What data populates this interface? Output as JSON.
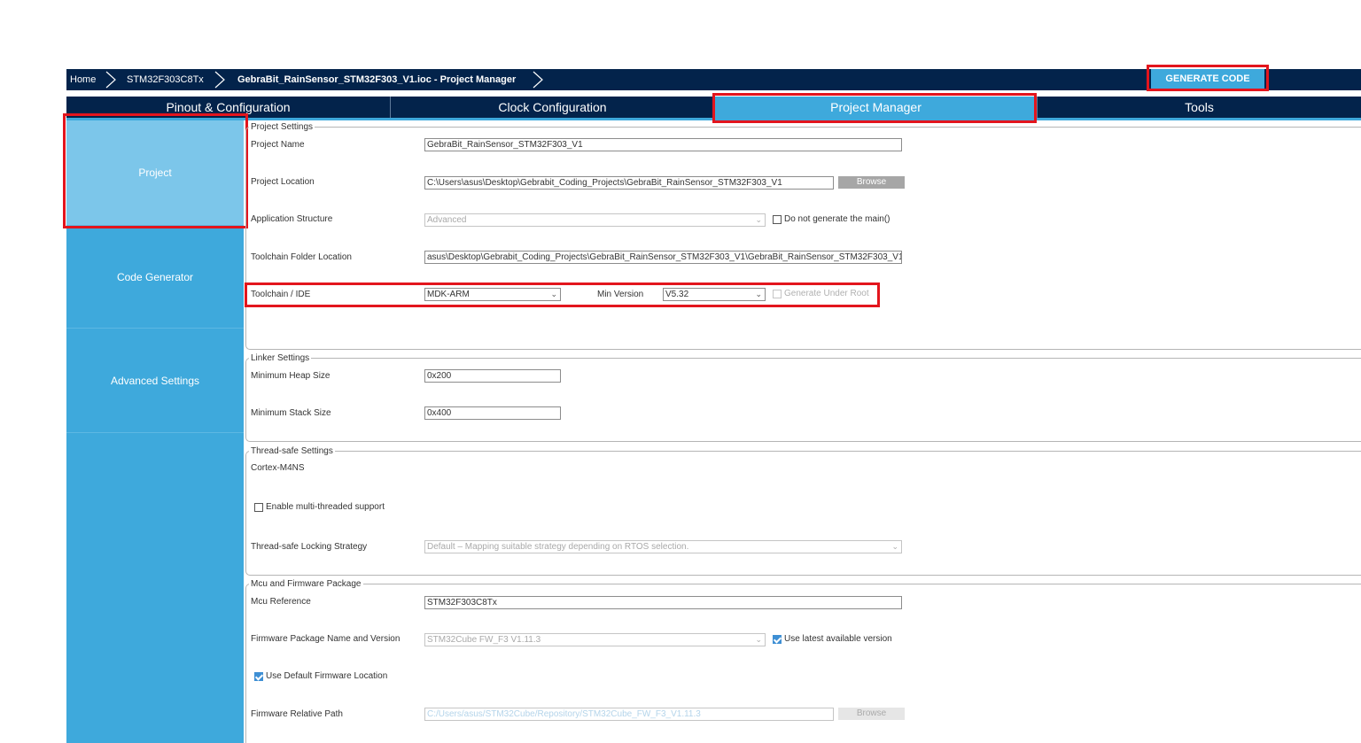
{
  "breadcrumb": {
    "home": "Home",
    "mcu": "STM32F303C8Tx",
    "file": "GebraBit_RainSensor_STM32F303_V1.ioc - Project Manager"
  },
  "toolbar": {
    "generate_code": "GENERATE CODE"
  },
  "tabs": [
    {
      "label": "Pinout & Configuration"
    },
    {
      "label": "Clock Configuration"
    },
    {
      "label": "Project Manager"
    },
    {
      "label": "Tools"
    }
  ],
  "sidebar": {
    "items": [
      {
        "label": "Project"
      },
      {
        "label": "Code Generator"
      },
      {
        "label": "Advanced Settings"
      }
    ]
  },
  "project_settings": {
    "title": "Project Settings",
    "project_name_label": "Project Name",
    "project_name": "GebraBit_RainSensor_STM32F303_V1",
    "project_location_label": "Project Location",
    "project_location": "C:\\Users\\asus\\Desktop\\Gebrabit_Coding_Projects\\GebraBit_RainSensor_STM32F303_V1",
    "browse": "Browse",
    "app_structure_label": "Application Structure",
    "app_structure": "Advanced",
    "no_main_label": "Do not generate the main()",
    "toolchain_folder_label": "Toolchain Folder Location",
    "toolchain_folder": "asus\\Desktop\\Gebrabit_Coding_Projects\\GebraBit_RainSensor_STM32F303_V1\\GebraBit_RainSensor_STM32F303_V1\\",
    "toolchain_label": "Toolchain / IDE",
    "toolchain": "MDK-ARM",
    "min_version_label": "Min Version",
    "min_version": "V5.32",
    "gen_under_root_label": "Generate Under Root"
  },
  "linker_settings": {
    "title": "Linker Settings",
    "heap_label": "Minimum Heap Size",
    "heap": "0x200",
    "stack_label": "Minimum Stack Size",
    "stack": "0x400"
  },
  "thread_safe": {
    "title": "Thread-safe Settings",
    "core": "Cortex-M4NS",
    "multithread_label": "Enable multi-threaded support",
    "locking_label": "Thread-safe Locking Strategy",
    "locking": "Default – Mapping suitable strategy depending on RTOS selection."
  },
  "mcu_firmware": {
    "title": "Mcu and Firmware Package",
    "mcu_ref_label": "Mcu Reference",
    "mcu_ref": "STM32F303C8Tx",
    "fw_name_label": "Firmware Package Name and Version",
    "fw_name": "STM32Cube FW_F3 V1.11.3",
    "use_latest_label": "Use latest available version",
    "use_default_label": "Use Default Firmware Location",
    "fw_path_label": "Firmware Relative Path",
    "fw_path": "C:/Users/asus/STM32Cube/Repository/STM32Cube_FW_F3_V1.11.3",
    "browse": "Browse"
  },
  "colors": {
    "nav_dark": "#03234b",
    "accent": "#3ea9dc",
    "sidebar_active": "#7cc6ea",
    "highlight": "#e3151d"
  }
}
